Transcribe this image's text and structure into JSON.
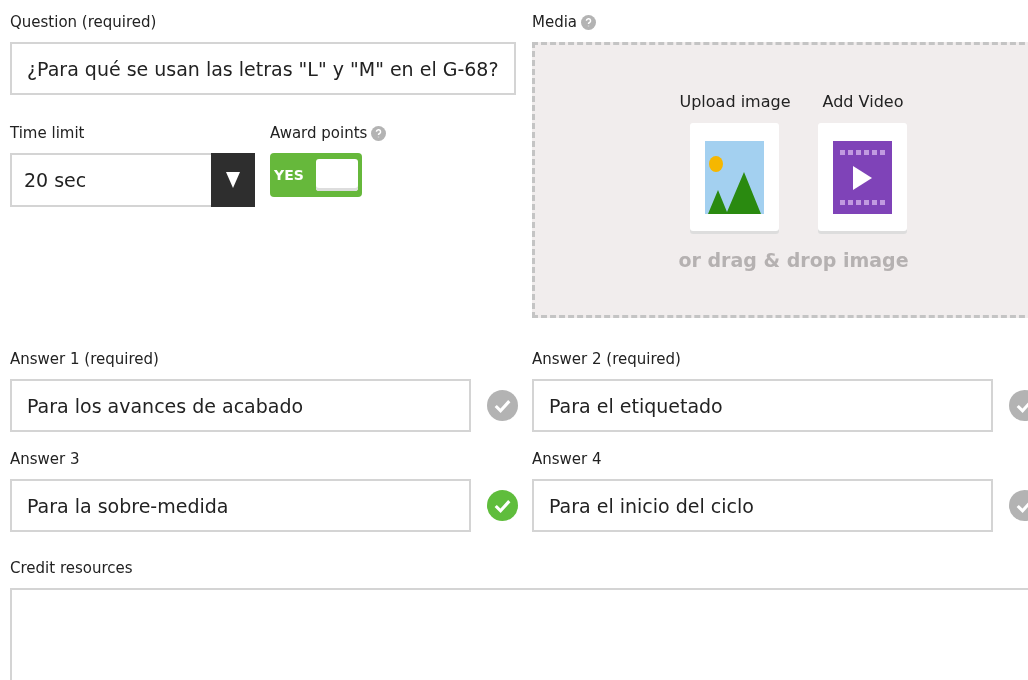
{
  "question": {
    "label": "Question (required)",
    "value": "¿Para qué se usan las letras \"L\" y \"M\" en el G-68?"
  },
  "time_limit": {
    "label": "Time limit",
    "value": "20 sec"
  },
  "award_points": {
    "label": "Award points",
    "toggle_text": "YES",
    "on": true
  },
  "media": {
    "label": "Media",
    "upload_image": "Upload image",
    "add_video": "Add Video",
    "drop_hint": "or drag & drop image"
  },
  "answers": [
    {
      "label": "Answer 1 (required)",
      "value": "Para los avances de acabado",
      "correct": false
    },
    {
      "label": "Answer 2 (required)",
      "value": "Para el etiquetado",
      "correct": false
    },
    {
      "label": "Answer 3",
      "value": "Para la sobre-medida",
      "correct": true
    },
    {
      "label": "Answer 4",
      "value": "Para el inicio del ciclo",
      "correct": false
    }
  ],
  "credit_resources": {
    "label": "Credit resources"
  }
}
